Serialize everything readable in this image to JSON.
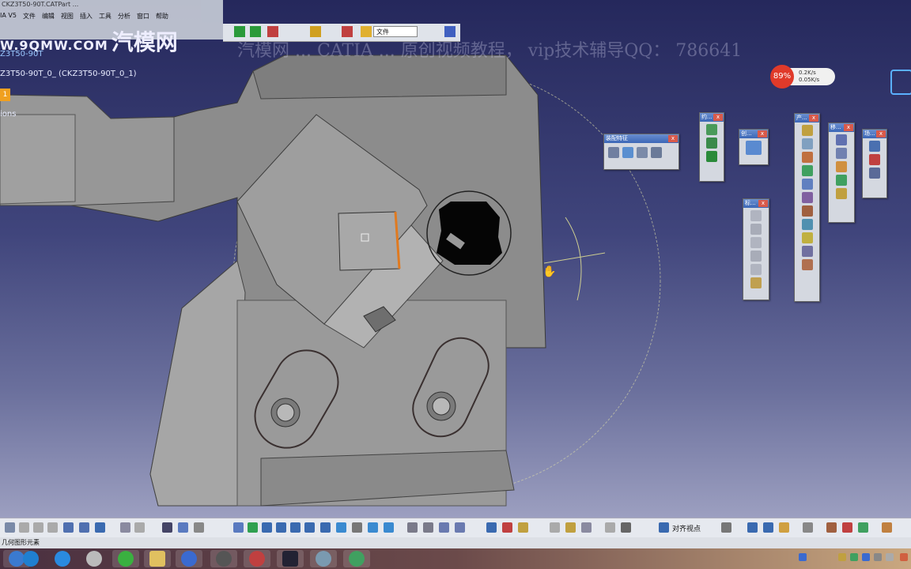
{
  "window": {
    "title": "CKZ3T50-90T.CATPart - CATIA V5",
    "title_clip": "CKZ3T50-90T.CATPart ...",
    "menu": [
      "IA V5",
      "文件",
      "编辑",
      "视图",
      "插入",
      "工具",
      "分析",
      "窗口",
      "帮助"
    ]
  },
  "watermark": {
    "site_url": "W.9QMW.COM",
    "site_name": "汽模网",
    "overlay_text": "汽模网 ... CATIA ... 原创视频教程， vip技术辅导QQ： 786641"
  },
  "toolbar_top": {
    "combo_value": "文件"
  },
  "tree": {
    "root": "Z3T50-90T",
    "part": "Z3T50-90T_0_ (CKZ3T50-90T_0_1)",
    "badge": "1",
    "node": "ions"
  },
  "net_widget": {
    "percent": "89%",
    "up": "0.2K/s",
    "down": "0.05K/s"
  },
  "palettes": [
    {
      "title": "装配特征",
      "icons": 4
    },
    {
      "title": "约...",
      "icons": 3
    },
    {
      "title": "创...",
      "icons": 1
    },
    {
      "title": "产...",
      "icons": 11
    },
    {
      "title": "标...",
      "icons": 6
    },
    {
      "title": "移...",
      "icons": 5
    },
    {
      "title": "场...",
      "icons": 3
    }
  ],
  "bottom_toolbar": {
    "align_label": "对齐视点"
  },
  "status_bar": {
    "text": "几何图形元素"
  },
  "colors": {
    "viewport_top": "#25285c",
    "part_fill": "#8e8e8e",
    "palette_header": "#3b66b6",
    "selection_edge": "#e07a20"
  }
}
